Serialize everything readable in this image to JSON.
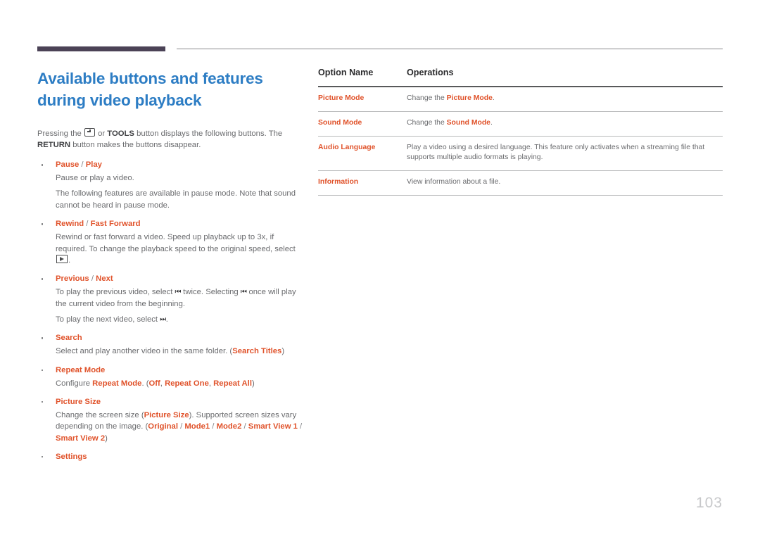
{
  "header": {
    "accent_rule_color": "#4b4256",
    "thin_rule_color": "#8a8a8d"
  },
  "title": {
    "line1": "Available buttons and features",
    "line2": "during video playback",
    "color": "#2d7dc4"
  },
  "intro": {
    "before_icon": "Pressing the ",
    "icon": "enter-key-icon",
    "after_icon": " or ",
    "tools_label": "TOOLS",
    "mid": " button displays the following buttons. The ",
    "return_label": "RETURN",
    "tail": " button makes the buttons disappear."
  },
  "bullets": [
    {
      "head_parts": [
        "Pause",
        " / ",
        "Play"
      ],
      "body": [
        "Pause or play a video.",
        "The following features are available in pause mode. Note that sound cannot be heard in pause mode."
      ]
    },
    {
      "head_parts": [
        "Rewind",
        " / ",
        "Fast Forward"
      ],
      "body_prefix": "Rewind or fast forward a video. Speed up playback up to 3x, if required. To change the playback speed to the original speed, select ",
      "body_icon": "play-box-icon",
      "body_suffix": "."
    },
    {
      "head_parts": [
        "Previous",
        " / ",
        "Next"
      ],
      "prev_line_a": "To play the previous video, select ",
      "prev_icon1": "skip-backward-icon",
      "prev_line_b": " twice. Selecting ",
      "prev_icon2": "skip-backward-icon",
      "prev_line_c": " once will play the current video from the beginning.",
      "next_line_a": "To play the next video, select ",
      "next_icon": "skip-forward-icon",
      "next_line_b": "."
    },
    {
      "head_parts": [
        "Search"
      ],
      "search_prefix": "Select and play another video in the same folder. (",
      "search_value": "Search Titles",
      "search_suffix": ")"
    },
    {
      "head_parts": [
        "Repeat Mode"
      ],
      "repeat_prefix": "Configure ",
      "repeat_term": "Repeat Mode",
      "repeat_mid": ". (",
      "repeat_opt1": "Off",
      "repeat_sep1": ", ",
      "repeat_opt2": "Repeat One",
      "repeat_sep2": ", ",
      "repeat_opt3": "Repeat All",
      "repeat_suffix": ")"
    },
    {
      "head_parts": [
        "Picture Size"
      ],
      "ps_prefix": "Change the screen size (",
      "ps_term": "Picture Size",
      "ps_mid": "). Supported screen sizes vary depending on the image. (",
      "ps_opt1": "Original",
      "ps_opt2": "Mode1",
      "ps_opt3": "Mode2",
      "ps_opt4": "Smart View 1",
      "ps_opt5": "Smart View 2",
      "ps_slash": " / ",
      "ps_suffix": ")"
    },
    {
      "head_parts": [
        "Settings"
      ]
    }
  ],
  "table": {
    "headers": [
      "Option Name",
      "Operations"
    ],
    "rows": [
      {
        "name": "Picture Mode",
        "ops_prefix": "Change the ",
        "ops_term": "Picture Mode",
        "ops_suffix": "."
      },
      {
        "name": "Sound Mode",
        "ops_prefix": "Change the ",
        "ops_term": "Sound Mode",
        "ops_suffix": "."
      },
      {
        "name": "Audio Language",
        "ops_prefix": "Play a video using a desired language. This feature only activates when a streaming file that supports multiple audio formats is playing.",
        "ops_term": "",
        "ops_suffix": ""
      },
      {
        "name": "Information",
        "ops_prefix": "View information about a file.",
        "ops_term": "",
        "ops_suffix": ""
      }
    ]
  },
  "footer": {
    "page_number": "103"
  }
}
